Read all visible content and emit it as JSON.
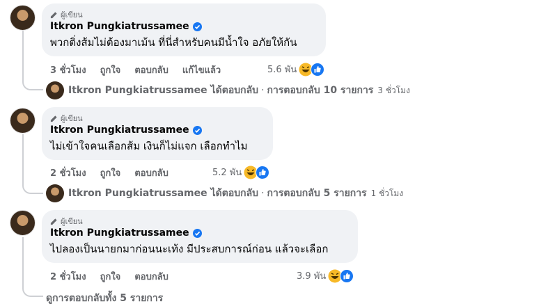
{
  "author_badge": "ผู้เขียน",
  "author_name": "Itkron Pungkiatrussamee",
  "comments": [
    {
      "text": "พวกติ่งส้มไม่ต้องมาเม้น ที่นี่สำหรับคนมีน้ำใจ อภัยให้กัน",
      "time": "3 ชั่วโมง",
      "like": "ถูกใจ",
      "reply": "ตอบกลับ",
      "edited": "แก้ไขแล้ว",
      "reaction_count": "5.6 พัน",
      "reply_summary": {
        "name": "Itkron Pungkiatrussamee",
        "action": "ได้ตอบกลับ",
        "sep": "·",
        "count_text": "การตอบกลับ 10 รายการ",
        "time": "3 ชั่วโมง"
      }
    },
    {
      "text": "ไม่เข้าใจคนเลือกส้ม เงินก็ไม่แจก เลือกทำไม",
      "time": "2 ชั่วโมง",
      "like": "ถูกใจ",
      "reply": "ตอบกลับ",
      "reaction_count": "5.2 พัน",
      "reply_summary": {
        "name": "Itkron Pungkiatrussamee",
        "action": "ได้ตอบกลับ",
        "sep": "·",
        "count_text": "การตอบกลับ 5 รายการ",
        "time": "1 ชั่วโมง"
      }
    },
    {
      "text": "ไปลองเป็นนายกมาก่อนนะเท้ง มีประสบการณ์ก่อน แล้วจะเลือก",
      "time": "2 ชั่วโมง",
      "like": "ถูกใจ",
      "reply": "ตอบกลับ",
      "reaction_count": "3.9 พัน",
      "view_all": "ดูการตอบกลับทั้ง 5 รายการ"
    }
  ],
  "colors": {
    "bubble": "#f0f2f5",
    "meta": "#65676b",
    "verified": "#1877f2",
    "like_blue": "#1877f2",
    "haha_yellow": "#f7b928"
  },
  "icons": [
    "pen-icon",
    "verified-badge-icon",
    "haha-reaction-icon",
    "like-reaction-icon"
  ]
}
